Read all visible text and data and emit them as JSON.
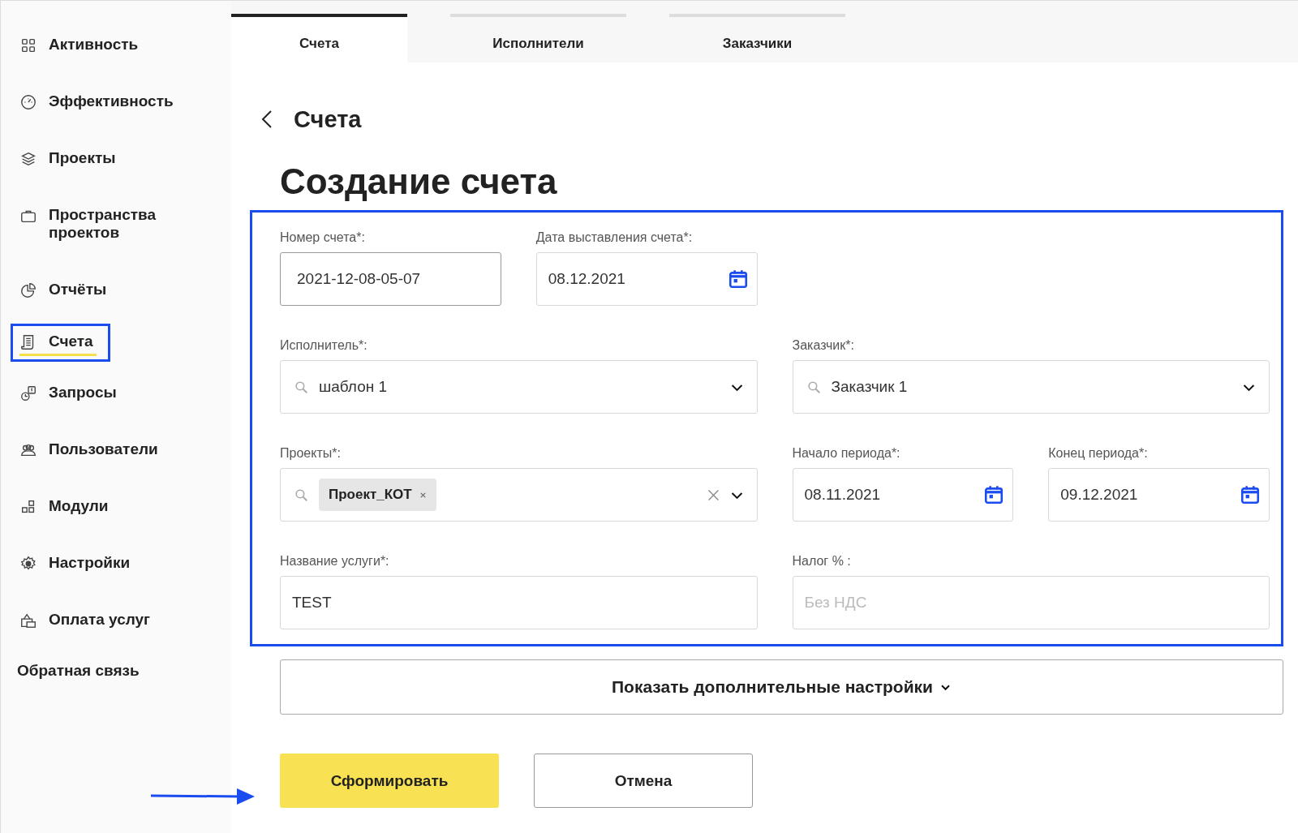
{
  "sidebar": {
    "items": [
      {
        "label": "Активность",
        "selected": false,
        "highlighted": false
      },
      {
        "label": "Эффективность",
        "selected": false,
        "highlighted": false
      },
      {
        "label": "Проекты",
        "selected": false,
        "highlighted": false
      },
      {
        "label": "Пространства проектов",
        "selected": false,
        "highlighted": false
      },
      {
        "label": "Отчёты",
        "selected": false,
        "highlighted": false
      },
      {
        "label": "Счета",
        "selected": true,
        "highlighted": true
      },
      {
        "label": "Запросы",
        "selected": false,
        "highlighted": false
      },
      {
        "label": "Пользователи",
        "selected": false,
        "highlighted": false
      },
      {
        "label": "Модули",
        "selected": false,
        "highlighted": false
      },
      {
        "label": "Настройки",
        "selected": false,
        "highlighted": false
      },
      {
        "label": "Оплата услуг",
        "selected": false,
        "highlighted": false
      }
    ],
    "footer_link": "Обратная связь"
  },
  "tabs": [
    {
      "label": "Счета",
      "selected": true
    },
    {
      "label": "Исполнители",
      "selected": false
    },
    {
      "label": "Заказчики",
      "selected": false
    }
  ],
  "breadcrumb": "Счета",
  "title": "Создание счета",
  "form": {
    "highlighted": true,
    "rows": [
      [
        {
          "kind": "short",
          "label": "Номер счета*:",
          "value": "2021-12-08-05-07"
        },
        {
          "kind": "date",
          "label": "Дата выставления счета*:",
          "value": "08.12.2021"
        }
      ],
      [
        {
          "kind": "select",
          "label": "Исполнитель*:",
          "value": "шаблон 1"
        },
        {
          "kind": "select",
          "label": "Заказчик*:",
          "value": "Заказчик 1"
        }
      ],
      [
        {
          "kind": "multiselect",
          "label": "Проекты*:",
          "tags": [
            "Проект_КОТ"
          ]
        },
        {
          "kind": "date",
          "label": "Начало периода*:",
          "value": "08.11.2021"
        },
        {
          "kind": "date",
          "label": "Конец периода*:",
          "value": "09.12.2021"
        }
      ],
      [
        {
          "kind": "text",
          "label": "Название услуги*:",
          "value": "TEST"
        },
        {
          "kind": "text",
          "label": "Налог % :",
          "placeholder": "Без НДС"
        }
      ]
    ]
  },
  "more_settings": "Показать дополнительные настройки",
  "buttons": [
    {
      "kind": "primary",
      "label": "Сформировать"
    },
    {
      "kind": "secondary",
      "label": "Отмена"
    }
  ],
  "pointer_arrow": true
}
